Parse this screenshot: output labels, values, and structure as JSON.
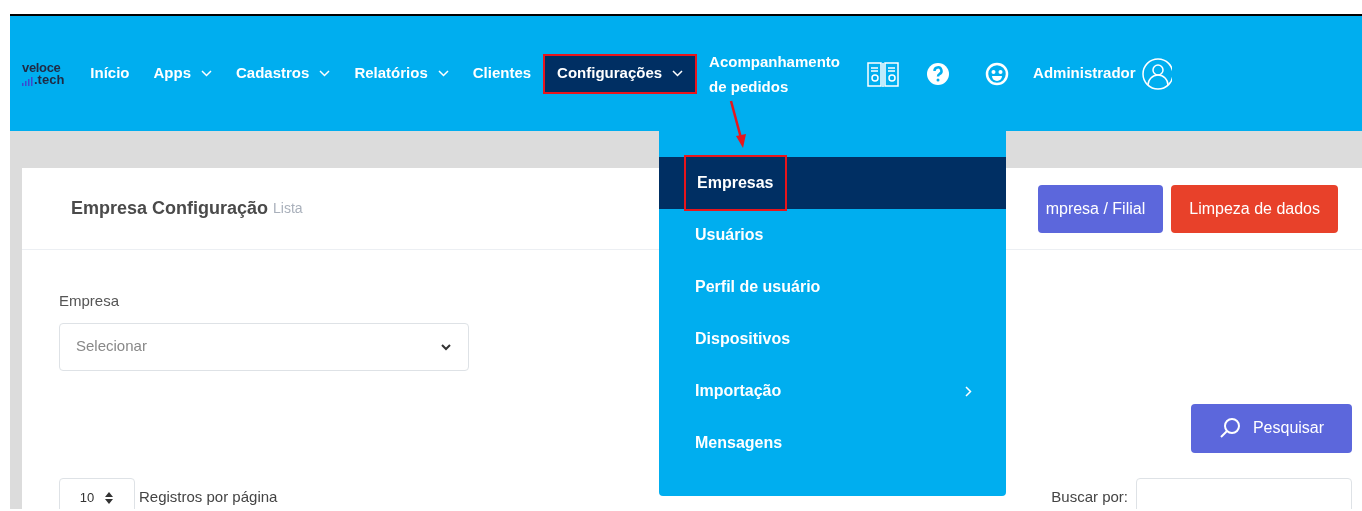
{
  "header": {
    "logo": {
      "line1": "veloce",
      "line2": ".tech"
    },
    "nav": [
      {
        "label": "Início",
        "caret": false,
        "selected": false,
        "annotated": false
      },
      {
        "label": "Apps",
        "caret": true,
        "selected": false,
        "annotated": false
      },
      {
        "label": "Cadastros",
        "caret": true,
        "selected": false,
        "annotated": false
      },
      {
        "label": "Relatórios",
        "caret": true,
        "selected": false,
        "annotated": false
      },
      {
        "label": "Clientes",
        "caret": false,
        "selected": false,
        "annotated": false
      },
      {
        "label": "Configurações",
        "caret": true,
        "selected": true,
        "annotated": true
      },
      {
        "label": "Acompanhamento de pedidos",
        "caret": false,
        "selected": false,
        "annotated": false
      }
    ],
    "user": "Administrador"
  },
  "menu": {
    "items": [
      {
        "label": "Empresas",
        "selected": true,
        "submenu": false,
        "annotated": true
      },
      {
        "label": "Usuários",
        "selected": false,
        "submenu": false,
        "annotated": false
      },
      {
        "label": "Perfil de usuário",
        "selected": false,
        "submenu": false,
        "annotated": false
      },
      {
        "label": "Dispositivos",
        "selected": false,
        "submenu": false,
        "annotated": false
      },
      {
        "label": "Importação",
        "selected": false,
        "submenu": true,
        "annotated": false
      },
      {
        "label": "Mensagens",
        "selected": false,
        "submenu": false,
        "annotated": false
      }
    ]
  },
  "page": {
    "title": "Empresa Configuração",
    "subtitle": "Lista",
    "buttons": [
      {
        "label": "mpresa / Filial",
        "kind": "primary"
      },
      {
        "label": "Limpeza de dados",
        "kind": "danger"
      }
    ],
    "filter": {
      "label": "Empresa",
      "placeholder": "Selecionar"
    },
    "search_button": "Pesquisar",
    "page_size": {
      "value": "10",
      "label": "Registros por página"
    },
    "search": {
      "label": "Buscar por:"
    }
  }
}
